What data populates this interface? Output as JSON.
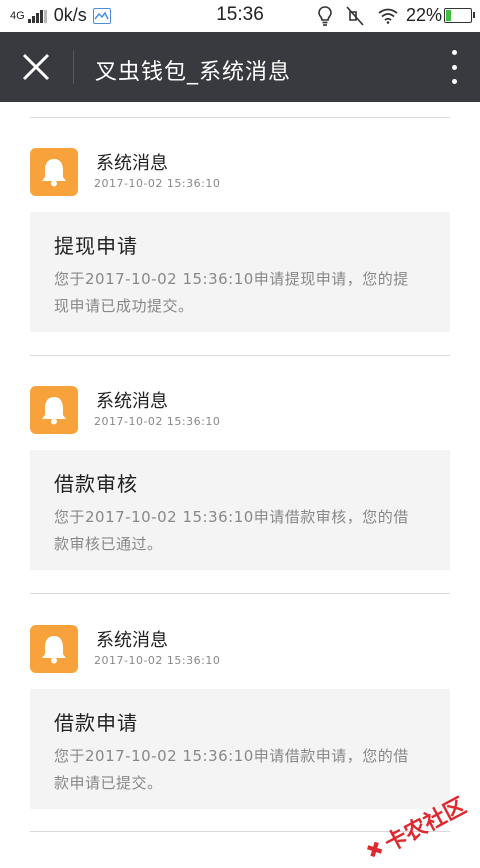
{
  "status_bar": {
    "network": "4G",
    "speed": "0k/s",
    "time": "15:36",
    "battery": "22%",
    "battery_level": 0.22
  },
  "header": {
    "title": "叉虫钱包_系统消息",
    "close_icon": "close-icon",
    "more_icon": "more-vertical-icon",
    "background": "#393a3f"
  },
  "messages": [
    {
      "sender": "系统消息",
      "time": "2017-10-02 15:36:10",
      "title": "提现申请",
      "body": "您于2017-10-02 15:36:10申请提现申请，您的提现申请已成功提交。"
    },
    {
      "sender": "系统消息",
      "time": "2017-10-02 15:36:10",
      "title": "借款审核",
      "body": "您于2017-10-02 15:36:10申请借款审核，您的借款审核已通过。"
    },
    {
      "sender": "系统消息",
      "time": "2017-10-02 15:36:10",
      "title": "借款申请",
      "body": "您于2017-10-02 15:36:10申请借款申请，您的借款申请已提交。"
    }
  ],
  "icon_color": "#f7a23a",
  "watermark": "卡农社区"
}
